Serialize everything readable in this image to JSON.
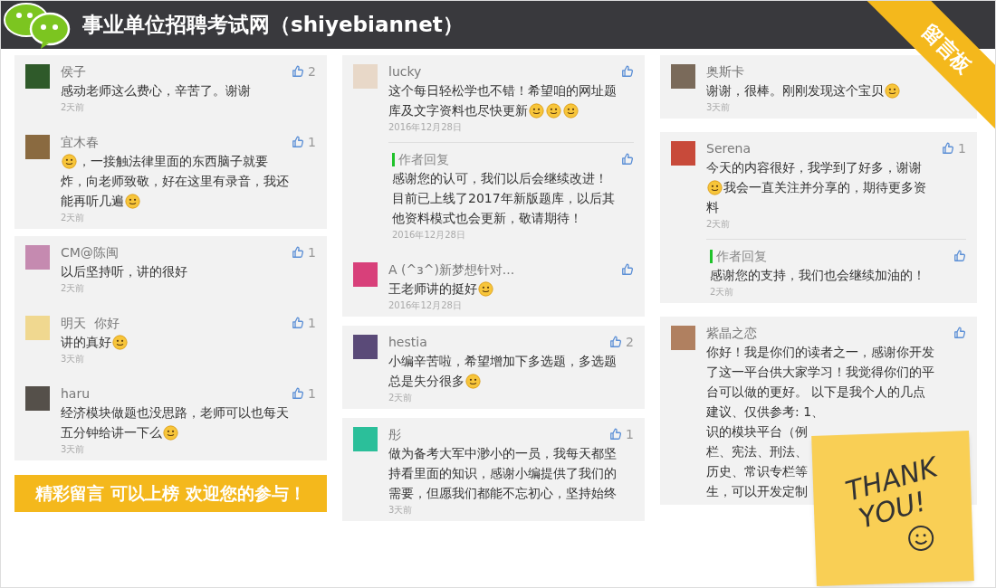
{
  "header": {
    "title": "事业单位招聘考试网（shiyebiannet）",
    "ribbon": "留言板"
  },
  "columns": [
    {
      "cards": [
        {
          "comments": [
            {
              "name": "侯子",
              "color": "#2f5a2a",
              "like_icon": true,
              "likes": "2",
              "lines": [
                [
                  {
                    "kind": "text",
                    "text": "感动老师这么费心，辛苦了。谢谢"
                  }
                ]
              ],
              "date": "2天前"
            },
            {
              "name": "宜木春",
              "color": "#8a6a40",
              "like_icon": true,
              "likes": "1",
              "lines": [
                [
                  {
                    "kind": "emoji"
                  },
                  {
                    "kind": "text",
                    "text": "，一接触法律里面的东西脑子就要"
                  }
                ],
                [
                  {
                    "kind": "text",
                    "text": "炸，向老师致敬，好在这里有录音，我还"
                  }
                ],
                [
                  {
                    "kind": "text",
                    "text": "能再听几遍"
                  },
                  {
                    "kind": "emoji"
                  }
                ]
              ],
              "date": "2天前"
            }
          ]
        },
        {
          "comments": [
            {
              "name": "CM@陈闽",
              "color": "#c58ab0",
              "like_icon": true,
              "likes": "1",
              "lines": [
                [
                  {
                    "kind": "text",
                    "text": "以后坚持听，讲的很好"
                  }
                ]
              ],
              "date": "2天前"
            },
            {
              "name": "明天  你好",
              "color": "#f0d890",
              "like_icon": true,
              "likes": "1",
              "lines": [
                [
                  {
                    "kind": "text",
                    "text": "讲的真好"
                  },
                  {
                    "kind": "emoji"
                  }
                ]
              ],
              "date": "3天前"
            },
            {
              "name": "haru",
              "color": "#55504a",
              "like_icon": true,
              "likes": "1",
              "lines": [
                [
                  {
                    "kind": "text",
                    "text": "经济模块做题也没思路，老师可以也每天"
                  }
                ],
                [
                  {
                    "kind": "text",
                    "text": "五分钟给讲一下么"
                  },
                  {
                    "kind": "emoji"
                  }
                ]
              ],
              "date": "3天前"
            }
          ]
        }
      ]
    },
    {
      "cards": [
        {
          "comments": [
            {
              "name": "lucky",
              "color": "#e8d8c8",
              "like_icon": true,
              "lines": [
                [
                  {
                    "kind": "text",
                    "text": "这个每日轻松学也不错！希望咱的网址题"
                  }
                ],
                [
                  {
                    "kind": "text",
                    "text": "库及文字资料也尽快更新"
                  },
                  {
                    "kind": "emoji"
                  },
                  {
                    "kind": "emoji"
                  },
                  {
                    "kind": "emoji"
                  }
                ]
              ],
              "date": "2016年12月28日",
              "replies": [
                {
                  "label": "作者回复",
                  "like_icon": true,
                  "lines": [
                    [
                      {
                        "kind": "text",
                        "text": "感谢您的认可，我们以后会继续改进！"
                      }
                    ],
                    [
                      {
                        "kind": "text",
                        "text": "目前已上线了2017年新版题库，以后其"
                      }
                    ],
                    [
                      {
                        "kind": "text",
                        "text": "他资料模式也会更新，敬请期待！"
                      }
                    ]
                  ],
                  "date": "2016年12月28日"
                }
              ]
            },
            {
              "name": "A (^з^)新梦想针对...",
              "color": "#d8407a",
              "like_icon": true,
              "lines": [
                [
                  {
                    "kind": "text",
                    "text": "王老师讲的挺好"
                  },
                  {
                    "kind": "emoji"
                  }
                ]
              ],
              "date": "2016年12月28日"
            }
          ]
        },
        {
          "comments": [
            {
              "name": "hestia",
              "color": "#5a4a78",
              "like_icon": true,
              "likes": "2",
              "lines": [
                [
                  {
                    "kind": "text",
                    "text": "小编辛苦啦，希望增加下多选题，多选题"
                  }
                ],
                [
                  {
                    "kind": "text",
                    "text": "总是失分很多"
                  },
                  {
                    "kind": "emoji"
                  }
                ]
              ],
              "date": "2天前"
            }
          ]
        },
        {
          "comments": [
            {
              "name": "彤",
              "color": "#2bbf9a",
              "like_icon": true,
              "likes": "1",
              "lines": [
                [
                  {
                    "kind": "text",
                    "text": "做为备考大军中渺小的一员，我每天都坚"
                  }
                ],
                [
                  {
                    "kind": "text",
                    "text": "持看里面的知识，感谢小编提供了我们的"
                  }
                ],
                [
                  {
                    "kind": "text",
                    "text": "需要，但愿我们都能不忘初心，坚持始终"
                  }
                ]
              ],
              "date": "3天前"
            }
          ]
        }
      ]
    },
    {
      "cards": [
        {
          "comments": [
            {
              "name": "奥斯卡",
              "color": "#7a6a5a",
              "like_icon": false,
              "lines": [
                [
                  {
                    "kind": "text",
                    "text": "谢谢，很棒。刚刚发现这个宝贝"
                  },
                  {
                    "kind": "emoji"
                  }
                ]
              ],
              "date": "3天前"
            }
          ]
        },
        {
          "comments": [
            {
              "name": "Serena",
              "color": "#c84a3a",
              "like_icon": true,
              "likes": "1",
              "lines": [
                [
                  {
                    "kind": "text",
                    "text": "今天的内容很好，我学到了好多，谢谢"
                  }
                ],
                [
                  {
                    "kind": "emoji"
                  },
                  {
                    "kind": "text",
                    "text": "我会一直关注并分享的，期待更多资"
                  }
                ],
                [
                  {
                    "kind": "text",
                    "text": "料"
                  }
                ]
              ],
              "date": "2天前",
              "replies": [
                {
                  "label": "作者回复",
                  "like_icon": true,
                  "lines": [
                    [
                      {
                        "kind": "text",
                        "text": "感谢您的支持，我们也会继续加油的！"
                      }
                    ]
                  ],
                  "date": "2天前"
                }
              ]
            }
          ]
        },
        {
          "comments": [
            {
              "name": "紫晶之恋",
              "color": "#b08060",
              "like_icon": true,
              "lines": [
                [
                  {
                    "kind": "text",
                    "text": "你好！我是你们的读者之一，感谢你开发"
                  }
                ],
                [
                  {
                    "kind": "text",
                    "text": "了这一平台供大家学习！我觉得你们的平"
                  }
                ],
                [
                  {
                    "kind": "text",
                    "text": "台可以做的更好。 以下是我个人的几点"
                  }
                ],
                [
                  {
                    "kind": "text",
                    "text": "建议、仅供参考: 1、"
                  }
                ],
                [
                  {
                    "kind": "text",
                    "text": "识的模块平台（例"
                  }
                ],
                [
                  {
                    "kind": "text",
                    "text": "栏、宪法、刑法、"
                  }
                ],
                [
                  {
                    "kind": "text",
                    "text": "历史、常识专栏等"
                  }
                ],
                [
                  {
                    "kind": "text",
                    "text": "生，可以开发定制"
                  }
                ]
              ]
            }
          ]
        }
      ]
    }
  ],
  "banner": "精彩留言 可以上榜 欢迎您的参与！",
  "note": {
    "lines": [
      "THANK",
      "YOU!"
    ]
  }
}
